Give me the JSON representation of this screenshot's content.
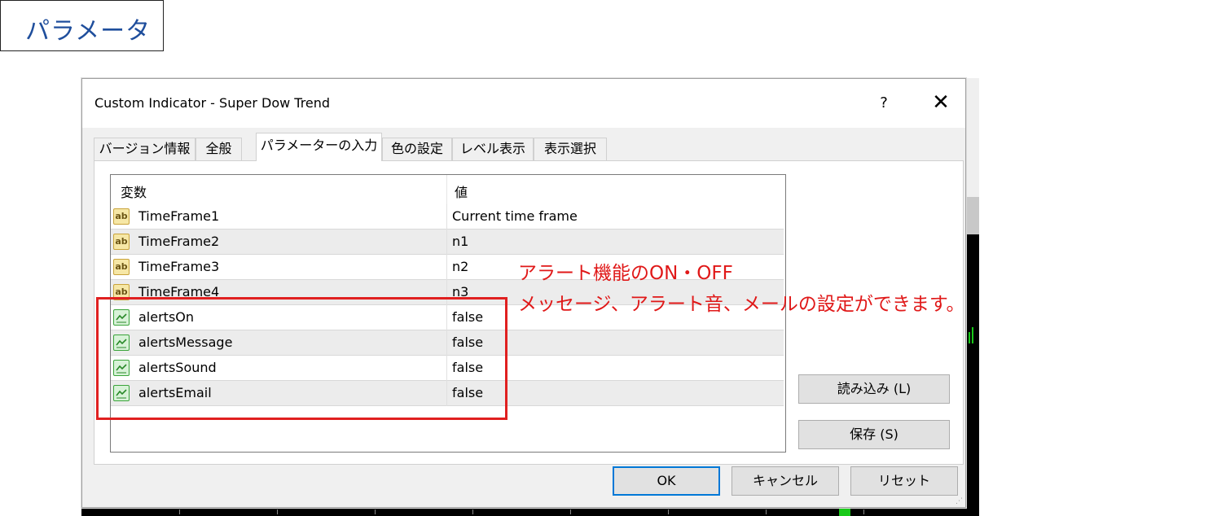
{
  "section_label": "パラメータ",
  "dialog": {
    "title": "Custom Indicator - Super Dow Trend",
    "help": "?",
    "close": "✕"
  },
  "tabs": [
    {
      "label": "バージョン情報",
      "active": false
    },
    {
      "label": "全般",
      "active": false
    },
    {
      "label": "パラメーターの入力",
      "active": true
    },
    {
      "label": "色の設定",
      "active": false
    },
    {
      "label": "レベル表示",
      "active": false
    },
    {
      "label": "表示選択",
      "active": false
    }
  ],
  "table": {
    "headers": {
      "variable": "変数",
      "value": "値"
    },
    "rows": [
      {
        "name": "TimeFrame1",
        "value": "Current time frame",
        "icon": "ab-string-icon"
      },
      {
        "name": "TimeFrame2",
        "value": "n1",
        "icon": "ab-string-icon"
      },
      {
        "name": "TimeFrame3",
        "value": "n2",
        "icon": "ab-string-icon"
      },
      {
        "name": "TimeFrame4",
        "value": "n3",
        "icon": "ab-string-icon"
      },
      {
        "name": "alertsOn",
        "value": "false",
        "icon": "bool-icon"
      },
      {
        "name": "alertsMessage",
        "value": "false",
        "icon": "bool-icon"
      },
      {
        "name": "alertsSound",
        "value": "false",
        "icon": "bool-icon"
      },
      {
        "name": "alertsEmail",
        "value": "false",
        "icon": "bool-icon"
      }
    ]
  },
  "buttons": {
    "load": "読み込み (L)",
    "save": "保存 (S)",
    "ok": "OK",
    "cancel": "キャンセル",
    "reset": "リセット"
  },
  "annotations": {
    "line1": "アラート機能のON・OFF",
    "line2": "メッセージ、アラート音、メールの設定ができます。"
  },
  "colors": {
    "annotation": "#e01818",
    "label_text": "#1f4e9c",
    "primary_border": "#0078d7"
  }
}
